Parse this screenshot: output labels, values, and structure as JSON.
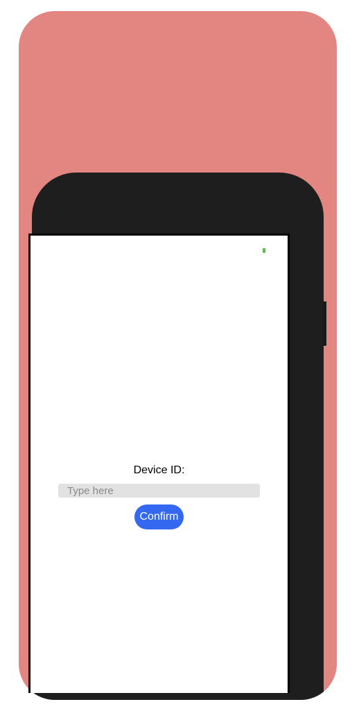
{
  "colors": {
    "page_background": "#ffffff",
    "card_background": "#e38580",
    "phone_frame": "#1e1e1e",
    "screen_background": "#ffffff",
    "input_background": "#e2e2e2",
    "button_background": "#3468f0",
    "battery_indicator": "#5cc04a"
  },
  "form": {
    "label": "Device ID:",
    "input_value": "",
    "input_placeholder": "Type here",
    "confirm_label": "Confirm"
  },
  "status_bar": {
    "battery_icon": "battery-icon"
  }
}
